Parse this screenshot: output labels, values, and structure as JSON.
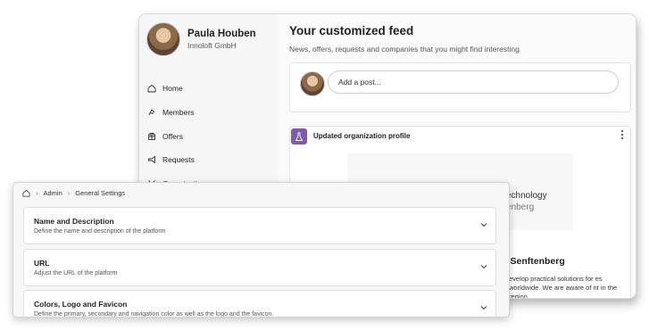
{
  "profile": {
    "name": "Paula Houben",
    "organization": "Innoloft GmbH"
  },
  "nav": {
    "items": [
      {
        "label": "Home",
        "icon": "home-icon"
      },
      {
        "label": "Members",
        "icon": "members-icon"
      },
      {
        "label": "Offers",
        "icon": "offers-icon"
      },
      {
        "label": "Requests",
        "icon": "requests-icon"
      },
      {
        "label": "Organizations",
        "icon": "organizations-icon"
      }
    ]
  },
  "feed": {
    "title": "Your customized feed",
    "subtitle": "News, offers, requests and companies that you might find interesting",
    "post_placeholder": "Add a post...",
    "activity": {
      "title": "Updated organization profile",
      "icon": "flask-icon",
      "logo_text_line1": "echnology",
      "logo_text_line2": "enberg",
      "org_name": "-Senftenberg",
      "description": "evelop practical solutions for es worldwide. We are aware of nt in the region"
    }
  },
  "settings": {
    "breadcrumb": [
      "Admin",
      "General Settings"
    ],
    "sections": [
      {
        "title": "Name and Description",
        "description": "Define the name and description of the platform"
      },
      {
        "title": "URL",
        "description": "Adjust the URL of the platform"
      },
      {
        "title": "Colors, Logo and Favicon",
        "description": "Define the primary, secondary and navigation color as well as the logo and the favicon."
      }
    ]
  },
  "colors": {
    "accent": "#7e5da7",
    "background": "#f7f7f7"
  }
}
